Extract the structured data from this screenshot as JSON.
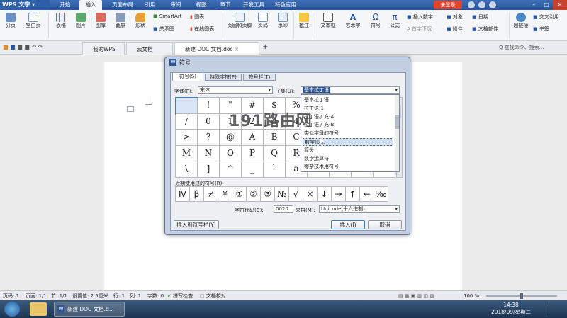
{
  "menubar": {
    "app_name": "WPS 文字",
    "items": [
      "开始",
      "插入",
      "页面布局",
      "引用",
      "审阅",
      "视图",
      "章节",
      "开发工具",
      "特色应用"
    ],
    "login": "未登录"
  },
  "ribbon": {
    "large": [
      {
        "label": "分页",
        "icon": "page-break-icon"
      },
      {
        "label": "空白页",
        "icon": "blank-page-icon"
      },
      {
        "label": "表格",
        "icon": "table-icon"
      },
      {
        "label": "图片",
        "icon": "image-icon"
      },
      {
        "label": "图库",
        "icon": "gallery-icon"
      },
      {
        "label": "截屏",
        "icon": "screenshot-icon"
      },
      {
        "label": "形状",
        "icon": "shape-icon"
      },
      {
        "label": "页眉和页脚",
        "icon": "header-footer-icon"
      },
      {
        "label": "页码",
        "icon": "page-number-icon"
      },
      {
        "label": "水印",
        "icon": "watermark-icon"
      },
      {
        "label": "批注",
        "icon": "comment-icon"
      },
      {
        "label": "文本框",
        "icon": "textbox-icon"
      },
      {
        "label": "艺术字",
        "icon": "wordart-icon"
      },
      {
        "label": "符号",
        "icon": "symbol-icon"
      },
      {
        "label": "公式",
        "icon": "formula-icon"
      },
      {
        "label": "超链接",
        "icon": "hyperlink-icon"
      }
    ],
    "small": {
      "smartart": "SmartArt",
      "chart": "图表",
      "relation": "关系图",
      "online_chart": "在线图表",
      "insert_number": "插入数字",
      "object": "对象",
      "date": "日期",
      "first_drop": "首字下沉",
      "attachment": "附件",
      "doc_part": "文档部件",
      "cross_ref": "交叉引用",
      "bookmark": "书签"
    }
  },
  "tabs": {
    "mywps": "我的WPS",
    "cloud": "云文档",
    "doc": "新建 DOC 文档.doc",
    "add": "+",
    "search": "查找命令、搜索..."
  },
  "dialog": {
    "title": "符号",
    "tabs": [
      "符号(S)",
      "特殊字符(P)",
      "符号栏(T)"
    ],
    "font_label": "字体(F):",
    "font_value": "宋体",
    "subset_label": "子集(U):",
    "subset_value": "基本拉丁语",
    "subset_options": [
      "基本拉丁语",
      "拉丁语-1",
      "拉丁语扩充-A",
      "拉丁语扩充-B",
      "类似字母的符号",
      "数字形式",
      "箭头",
      "数学运算符",
      "零杂技术用符号"
    ],
    "subset_selected": "数字形式",
    "grid": [
      [
        "",
        "!",
        "\"",
        "#",
        "$",
        "%",
        "&",
        "'",
        "(",
        ")"
      ],
      [
        "/",
        "0",
        "1",
        "2",
        "3",
        "4",
        "5",
        "6",
        "7",
        "8"
      ],
      [
        ">",
        "?",
        "@",
        "A",
        "B",
        "C",
        "D",
        "E",
        "F",
        "G"
      ],
      [
        "M",
        "N",
        "O",
        "P",
        "Q",
        "R",
        "S",
        "T",
        "U",
        "V"
      ],
      [
        "\\",
        "]",
        "^",
        "_",
        "`",
        "a",
        "b",
        "c",
        "d",
        "e"
      ]
    ],
    "recent_label": "近期使用过的符号(R):",
    "recent": [
      "Ⅳ",
      "β",
      "≠",
      "¥",
      "①",
      "②",
      "③",
      "№",
      "√",
      "×",
      "↓",
      "→",
      "↑",
      "←",
      "‰"
    ],
    "code_label": "字符代码(C):",
    "code_value": "0020",
    "from_label": "来自(M):",
    "from_value": "Unicode(十六进制)",
    "insert_bar": "插入到符号栏(Y)",
    "insert": "插入(I)",
    "cancel": "取消"
  },
  "watermark": "191路由网",
  "status": {
    "page": "页码: 1",
    "pages": "页面: 1/1",
    "section": "节: 1/1",
    "setting": "设置值: 2.5厘米",
    "row": "行: 1",
    "col": "列: 1",
    "chars": "字数: 0",
    "spell": "拼写检查",
    "proof": "文档校对",
    "zoom": "100 %"
  },
  "taskbar": {
    "doc": "新建 DOC 文档.d...",
    "time": "14:38",
    "date": "2018/09/星期二"
  },
  "colors": {
    "accent": "#2a5699",
    "login": "#e0452e",
    "dialog_frame": "#c2cfe2"
  }
}
